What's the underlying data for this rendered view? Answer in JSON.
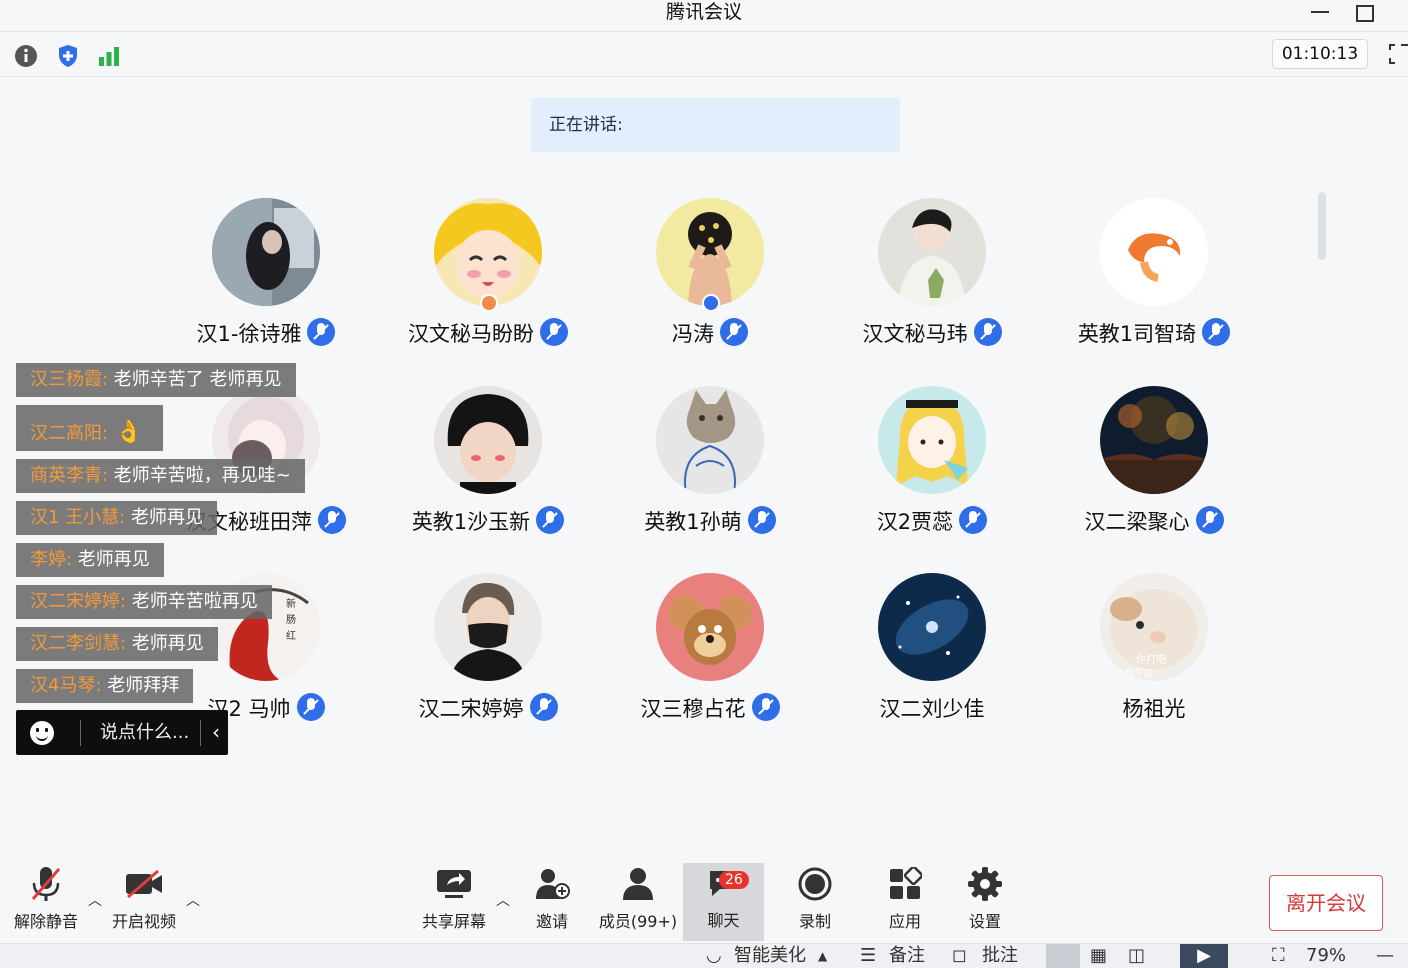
{
  "window": {
    "title": "腾讯会议"
  },
  "infobar": {
    "timer": "01:10:13"
  },
  "speaking": {
    "label": "正在讲话:"
  },
  "participants": [
    {
      "name": "汉1-徐诗雅",
      "avatar": "photo-girl-icon",
      "mic": true
    },
    {
      "name": "汉文秘马盼盼",
      "avatar": "sailor-moon-icon",
      "mic": true
    },
    {
      "name": "冯涛",
      "avatar": "flower-girl-icon",
      "mic": true
    },
    {
      "name": "汉文秘马玮",
      "avatar": "boy-sweater-icon",
      "mic": true
    },
    {
      "name": "英教1司智琦",
      "avatar": "shrimp-icon",
      "mic": true
    },
    {
      "name": "汉文秘班田萍",
      "avatar": "anime-girl-icon",
      "mic": true
    },
    {
      "name": "英教1沙玉新",
      "avatar": "boy-beanie-icon",
      "mic": true
    },
    {
      "name": "英教1孙萌",
      "avatar": "cat-icon",
      "mic": true
    },
    {
      "name": "汉2贾蕊",
      "avatar": "alice-icon",
      "mic": true
    },
    {
      "name": "汉二梁聚心",
      "avatar": "fireworks-icon",
      "mic": true
    },
    {
      "name": "汉2 马帅",
      "avatar": "red-ink-icon",
      "mic": true
    },
    {
      "name": "汉二宋婷婷",
      "avatar": "masked-man-icon",
      "mic": true
    },
    {
      "name": "汉三穆占花",
      "avatar": "jerry-mouse-icon",
      "mic": true
    },
    {
      "name": "汉二刘少佳",
      "avatar": "galaxy-icon",
      "mic": false
    },
    {
      "name": "杨祖光",
      "avatar": "hamster-icon",
      "mic": false
    }
  ],
  "chat": {
    "messages": [
      {
        "who": "汉三杨霞:",
        "text": " 老师辛苦了  老师再见"
      },
      {
        "who": "汉二高阳:",
        "text": " 👌"
      },
      {
        "who": "商英李青:",
        "text": " 老师辛苦啦，再见哇~"
      },
      {
        "who": "汉1 王小慧:",
        "text": " 老师再见"
      },
      {
        "who": "李婷:",
        "text": " 老师再见"
      },
      {
        "who": "汉二宋婷婷:",
        "text": " 老师辛苦啦再见"
      },
      {
        "who": "汉二李剑慧:",
        "text": " 老师再见"
      },
      {
        "who": "汉4马琴:",
        "text": " 老师拜拜"
      }
    ],
    "placeholder": "说点什么..."
  },
  "toolbar": {
    "unmute": "解除静音",
    "video": "开启视频",
    "share": "共享屏幕",
    "invite": "邀请",
    "members": "成员(99+)",
    "chat": "聊天",
    "chat_count": "26",
    "record": "录制",
    "apps": "应用",
    "settings": "设置",
    "leave": "离开会议"
  },
  "hoststrip": {
    "beauty": "智能美化",
    "notes": "备注",
    "annotate": "批注",
    "zoom": "79%"
  },
  "colors": {
    "accent": "#2f6ee8",
    "leave": "#d43a3a",
    "chat_name": "#f39a3c",
    "badge": "#e8332c"
  }
}
